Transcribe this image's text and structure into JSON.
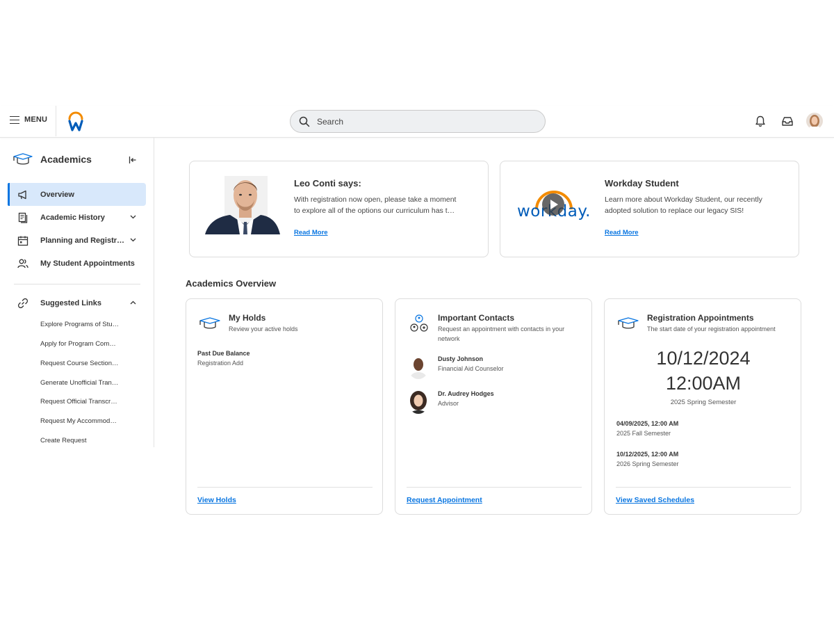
{
  "header": {
    "menu_label": "MENU",
    "search_placeholder": "Search"
  },
  "sidebar": {
    "title": "Academics",
    "nav": [
      {
        "label": "Overview",
        "icon": "megaphone-icon",
        "active": true
      },
      {
        "label": "Academic History",
        "icon": "document-history-icon"
      },
      {
        "label": "Planning and Registr…",
        "icon": "calendar-icon"
      },
      {
        "label": "My Student Appointments",
        "icon": "people-icon"
      }
    ],
    "suggested_title": "Suggested Links",
    "suggested_links": [
      "Explore Programs of Stu…",
      "Apply for Program Com…",
      "Request Course Section…",
      "Generate Unofficial Tran…",
      "Request Official Transcr…",
      "Request My Accommod…",
      "Create Request"
    ]
  },
  "promos": [
    {
      "title": "Leo Conti says:",
      "body_line1": "With registration now open, please take a moment",
      "body_line2": "to explore all of the options our curriculum has t…",
      "link": "Read More"
    },
    {
      "title": "Workday Student",
      "body_line1": "Learn more about Workday Student, our recently",
      "body_line2": "adopted solution to replace our legacy SIS!",
      "link": "Read More",
      "logo_text": "workday."
    }
  ],
  "overview": {
    "title": "Academics Overview",
    "holds": {
      "title": "My Holds",
      "subtitle": "Review your active holds",
      "item_title": "Past Due Balance",
      "item_sub": "Registration Add",
      "link": "View Holds"
    },
    "contacts": {
      "title": "Important Contacts",
      "subtitle": "Request an appointment with contacts in your network",
      "people": [
        {
          "name": "Dusty Johnson",
          "role": "Financial Aid Counselor"
        },
        {
          "name": "Dr. Audrey Hodges",
          "role": "Advisor"
        }
      ],
      "link": "Request Appointment"
    },
    "registration": {
      "title": "Registration Appointments",
      "subtitle": "The start date of your registration appointment",
      "big_date": "10/12/2024",
      "big_time": "12:00AM",
      "big_semester": "2025 Spring Semester",
      "appointments": [
        {
          "when": "04/09/2025, 12:00 AM",
          "semester": "2025 Fall Semester"
        },
        {
          "when": "10/12/2025, 12:00 AM",
          "semester": "2026 Spring Semester"
        }
      ],
      "link": "View Saved Schedules"
    }
  },
  "colors": {
    "accent": "#0875e1",
    "active_nav_bg": "#d8e8fb",
    "workday_orange": "#f38b00",
    "workday_blue": "#005cb9"
  }
}
